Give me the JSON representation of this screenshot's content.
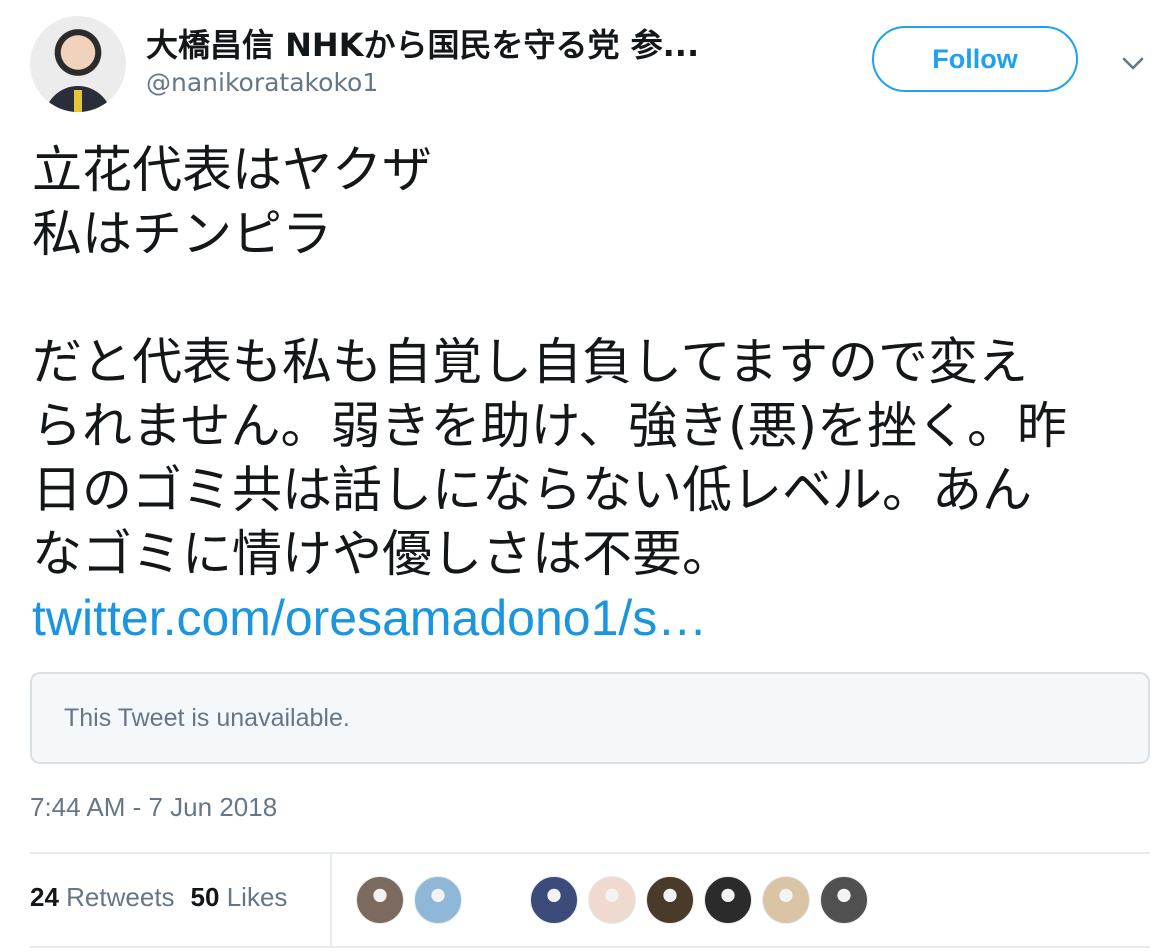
{
  "tweet": {
    "author": {
      "display_name": "大橋昌信 NHKから国民を守る党 参...",
      "handle": "@nanikoratakoko1"
    },
    "follow_label": "Follow",
    "text_lines": [
      "立花代表はヤクザ",
      "私はチンピラ",
      "",
      "だと代表も私も自覚し自負してますので変え",
      "られません。弱きを助け、強き(悪)を挫く。昨",
      "日のゴミ共は話しにならない低レベル。あん",
      "なゴミに情けや優しさは不要。"
    ],
    "link_text": "twitter.com/oresamadono1/s…",
    "quoted_unavailable": "This Tweet is unavailable.",
    "timestamp": "7:44 AM - 7 Jun 2018",
    "retweets_count": "24",
    "retweets_label": "Retweets",
    "likes_count": "50",
    "likes_label": "Likes",
    "liker_avatars": [
      {
        "name": "liker-avatar-1",
        "color": "#7d6a5e"
      },
      {
        "name": "liker-avatar-2",
        "color": "#8fb7d8"
      },
      {
        "name": "liker-avatar-3",
        "color": "#3b4b7a"
      },
      {
        "name": "liker-avatar-4",
        "color": "#f0d9cf"
      },
      {
        "name": "liker-avatar-5",
        "color": "#4a3a2a"
      },
      {
        "name": "liker-avatar-6",
        "color": "#2b2b2b"
      },
      {
        "name": "liker-avatar-7",
        "color": "#d9c4a5"
      },
      {
        "name": "liker-avatar-8",
        "color": "#505050"
      }
    ],
    "colors": {
      "accent": "#1da1f2",
      "link": "#1b95e0",
      "secondary_text": "#657786",
      "primary_text": "#14171a"
    }
  }
}
